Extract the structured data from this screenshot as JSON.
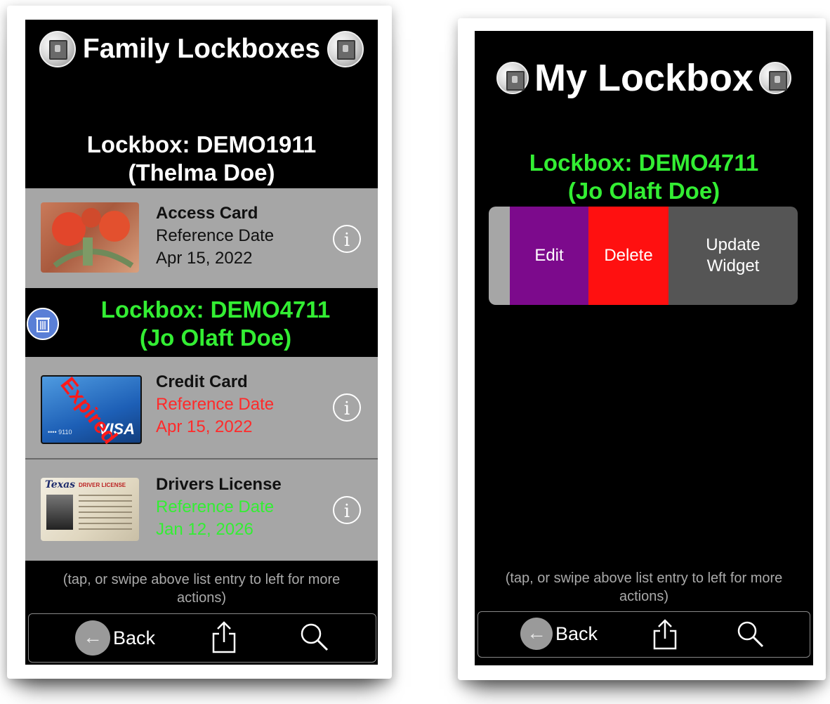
{
  "left": {
    "header": {
      "title": "Family Lockboxes",
      "left_icon": "safe-icon",
      "right_icon": "safe-icon"
    },
    "lockbox1": {
      "line1": "Lockbox: DEMO1911",
      "line2": "(Thelma Doe)"
    },
    "items_top": [
      {
        "name": "Access Card",
        "ref_label": "Reference Date",
        "ref_date": "Apr 15, 2022",
        "status_color": "#111111"
      }
    ],
    "lockbox2": {
      "line1": "Lockbox: DEMO4711",
      "line2": "(Jo Olaft Doe)",
      "color": "#33ee33",
      "trash_icon": "trash-icon"
    },
    "items_bottom": [
      {
        "name": "Credit Card",
        "ref_label": "Reference Date",
        "ref_date": "Apr 15, 2022",
        "status_color": "#ff2a2a",
        "badge": "Expired",
        "card_brand": "VISA",
        "card_number": "•••• 9110"
      },
      {
        "name": "Drivers License",
        "ref_label": "Reference Date",
        "ref_date": "Jan 12, 2026",
        "status_color": "#33ee33",
        "card_state": "Texas",
        "card_title": "DRIVER LICENSE"
      }
    ],
    "hint": "(tap, or swipe above list entry to left for more actions)",
    "toolbar": {
      "back_label": "Back",
      "back_icon": "arrow-left-icon",
      "share_icon": "share-icon",
      "search_icon": "search-icon"
    }
  },
  "right": {
    "header": {
      "title": "My Lockbox",
      "left_icon": "safe-icon",
      "right_icon": "safe-icon"
    },
    "lockbox": {
      "line1": "Lockbox: DEMO4711",
      "line2": "(Jo Olaft Doe)",
      "color": "#33ee33"
    },
    "swipe_actions": [
      {
        "label": "Edit",
        "color": "#7c0a8c"
      },
      {
        "label": "Delete",
        "color": "#ff1010"
      },
      {
        "label": "Update Widget",
        "color": "#555555"
      }
    ],
    "hint": "(tap, or swipe above list entry to left for more actions)",
    "toolbar": {
      "back_label": "Back",
      "back_icon": "arrow-left-icon",
      "share_icon": "share-icon",
      "search_icon": "search-icon"
    }
  }
}
